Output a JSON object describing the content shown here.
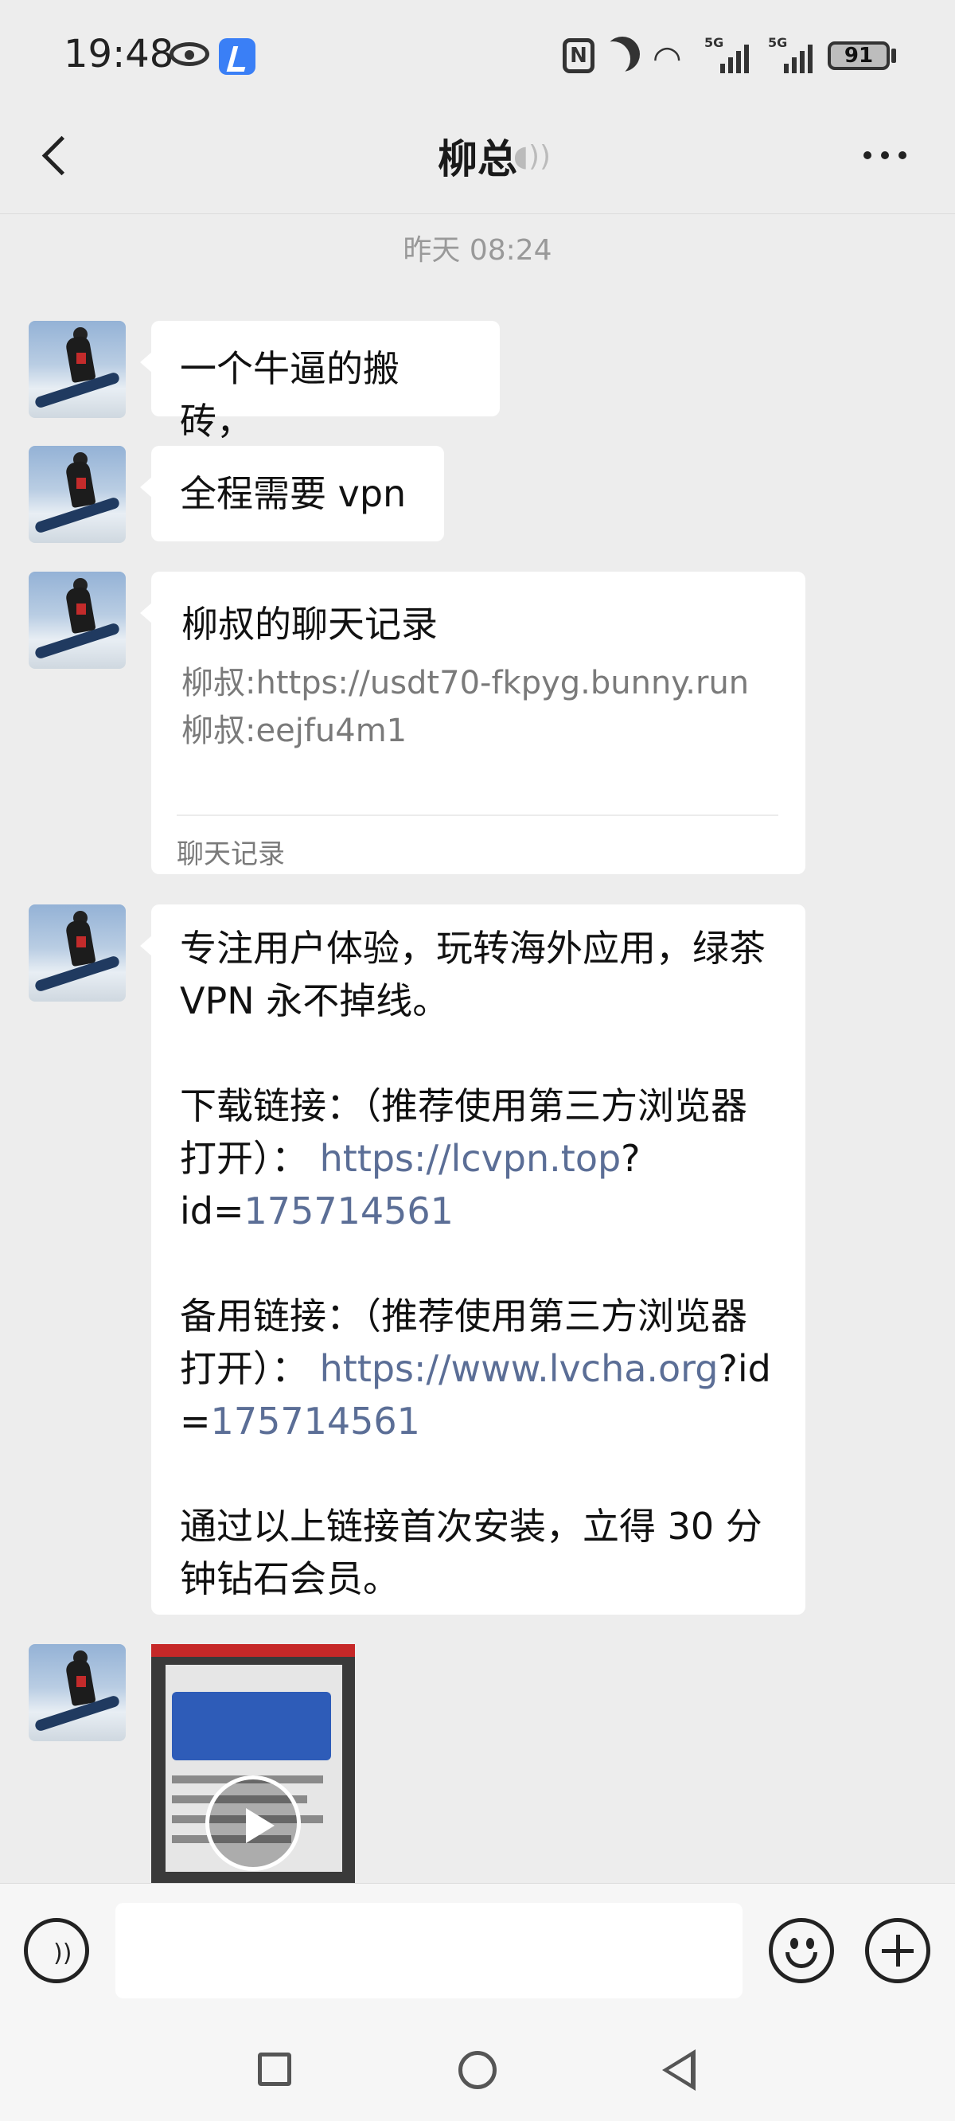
{
  "status_bar": {
    "time": "19:48",
    "network_1": "5G",
    "network_2": "5G",
    "battery": "91",
    "icons": [
      "eye-icon",
      "app-notification-icon",
      "nfc-icon",
      "do-not-disturb-icon",
      "wifi-icon",
      "signal-icon",
      "battery-icon"
    ]
  },
  "header": {
    "title": "柳总",
    "back_icon": "chevron-left-icon",
    "voice_mode_icon": "speaker-icon",
    "more_icon": "more-icon"
  },
  "chat": {
    "timestamp": "昨天 08:24",
    "messages": [
      {
        "type": "text",
        "text": "一个牛逼的搬砖，"
      },
      {
        "type": "text",
        "text": "全程需要 vpn"
      },
      {
        "type": "chat_record",
        "title": "柳叔的聊天记录",
        "lines": [
          "柳叔:https://usdt70-fkpyg.bunny.run",
          "柳叔:eejfu4m1"
        ],
        "footer": "聊天记录"
      },
      {
        "type": "rich_text",
        "intro": "专注用户体验，玩转海外应用，绿茶 VPN 永不掉线。",
        "download_label": "下载链接：（推荐使用第三方浏览器打开）：",
        "download_url_link": "https://lcvpn.top",
        "download_url_plain": "?id=",
        "download_id": "175714561",
        "backup_label": "备用链接：（推荐使用第三方浏览器打开）：",
        "backup_url_link": "https://www.lvcha.org",
        "backup_url_plain": "?id=",
        "backup_id": "175714561",
        "outro": "通过以上链接首次安装，立得 30 分钟钻石会员。"
      },
      {
        "type": "video",
        "icon": "play-icon"
      }
    ]
  },
  "input_bar": {
    "placeholder": "",
    "voice_icon": "voice-input-icon",
    "emoji_icon": "emoji-icon",
    "plus_icon": "plus-icon"
  },
  "system_nav": {
    "icons": [
      "recent-apps-icon",
      "home-icon",
      "back-icon"
    ]
  }
}
